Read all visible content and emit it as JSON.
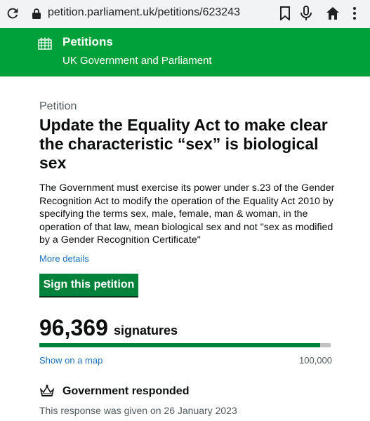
{
  "browser": {
    "url": "petition.parliament.uk/petitions/623243"
  },
  "header": {
    "brand": "Petitions",
    "subtitle": "UK Government and Parliament"
  },
  "petition": {
    "eyebrow": "Petition",
    "title": "Update the Equality Act to make clear the characteristic “sex” is biological sex",
    "description": "The Government must exercise its power under s.23 of the Gender Recognition Act to modify the operation of the Equality Act 2010 by specifying the terms sex, male, female, man & woman, in the operation of that law, mean biological sex and not \"sex as modified by a Gender Recognition Certificate\"",
    "more_details": "More details",
    "sign_button": "Sign this petition"
  },
  "signatures": {
    "count": "96,369",
    "label": "signatures",
    "show_map": "Show on a map",
    "target": "100,000",
    "progress_fraction": 0.96369
  },
  "government": {
    "title": "Government responded",
    "date_text": "This response was given on 26 January 2023"
  },
  "colors": {
    "header_green": "#00a03a",
    "button_green": "#00823b",
    "link_blue": "#1d70b8"
  }
}
